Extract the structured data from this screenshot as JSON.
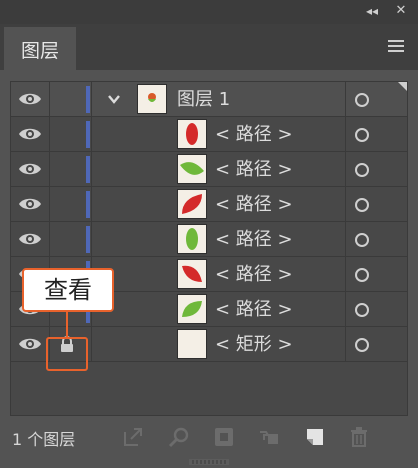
{
  "window": {
    "collapse_glyph": "◂◂",
    "close_glyph": "✕"
  },
  "tab": {
    "label": "图层"
  },
  "layers": {
    "parent": {
      "name": "图层  1",
      "thumb_icon": "layer-thumbnail-icon"
    },
    "rows": [
      {
        "label": "< 路径 >",
        "shape": "leaf-vertical",
        "color": "#d42a2a"
      },
      {
        "label": "< 路径 >",
        "shape": "leaf-horizontal",
        "color": "#6fb83a"
      },
      {
        "label": "< 路径 >",
        "shape": "leaf-diagonal",
        "color": "#d42a2a"
      },
      {
        "label": "< 路径 >",
        "shape": "leaf-vertical",
        "color": "#6fb83a"
      },
      {
        "label": "< 路径 >",
        "shape": "leaf-diagonal-down",
        "color": "#d42a2a"
      },
      {
        "label": "< 路径 >",
        "shape": "leaf-diagonal",
        "color": "#6fb83a"
      },
      {
        "label": "< 矩形 >",
        "shape": "rect",
        "color": "#f4efe6",
        "locked": true
      }
    ]
  },
  "footer": {
    "count": "1 个图层",
    "icons": [
      "collect-for-export-icon",
      "locate-object-icon",
      "make-clipping-mask-icon",
      "create-sublayer-icon",
      "create-new-layer-icon",
      "delete-icon"
    ]
  },
  "callout": {
    "text": "查看"
  },
  "colors": {
    "accent": "#e8622c",
    "layer_color": "#4f68b8",
    "panel_bg": "#535353"
  }
}
